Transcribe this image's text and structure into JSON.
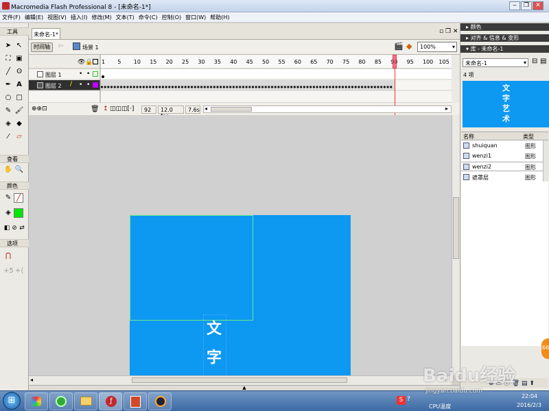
{
  "window": {
    "title": "Macromedia Flash Professional 8 - [未命名-1*]"
  },
  "menu": [
    "文件(F)",
    "编辑(E)",
    "视图(V)",
    "插入(I)",
    "修改(M)",
    "文本(T)",
    "命令(C)",
    "控制(O)",
    "窗口(W)",
    "帮助(H)"
  ],
  "toolbar": {
    "title": "工具",
    "view_label": "查看",
    "color_label": "颜色",
    "options_label": "选项"
  },
  "document": {
    "tab": "未命名-1*",
    "timeline_button": "时间轴",
    "scene": "场景 1",
    "zoom": "100%"
  },
  "timeline": {
    "frame_numbers": [
      "1",
      "5",
      "10",
      "15",
      "20",
      "25",
      "30",
      "35",
      "40",
      "45",
      "50",
      "55",
      "60",
      "65",
      "70",
      "75",
      "80",
      "85",
      "90",
      "95",
      "100",
      "105"
    ],
    "layers": [
      {
        "name": "图层 1",
        "selected": false
      },
      {
        "name": "图层 2",
        "selected": true
      }
    ],
    "current_frame": "92",
    "fps": "12.0 fps",
    "elapsed": "7.6s"
  },
  "stage": {
    "bg_color": "#0d98f2",
    "text_chars": [
      "文",
      "字"
    ]
  },
  "panels": {
    "color": "颜色",
    "align": "对齐 & 信息 & 变形",
    "library_title": "库 - 未命名-1",
    "library_doc": "未命名-1",
    "item_count": "4 项",
    "preview_text": [
      "文",
      "字",
      "艺",
      "术"
    ],
    "col_name": "名称",
    "col_type": "类型",
    "items": [
      {
        "name": "shuiquan",
        "type": "图形"
      },
      {
        "name": "wenzi1",
        "type": "图形"
      },
      {
        "name": "wenzi2",
        "type": "图形"
      },
      {
        "name": "遮罩层",
        "type": "图形"
      }
    ]
  },
  "taskbar": {
    "tray_label": "CPU温度",
    "time": "22:04",
    "date": "2016/2/3"
  },
  "watermark": {
    "text": "Baidu经验",
    "url": "jingyan.baidu.com"
  }
}
